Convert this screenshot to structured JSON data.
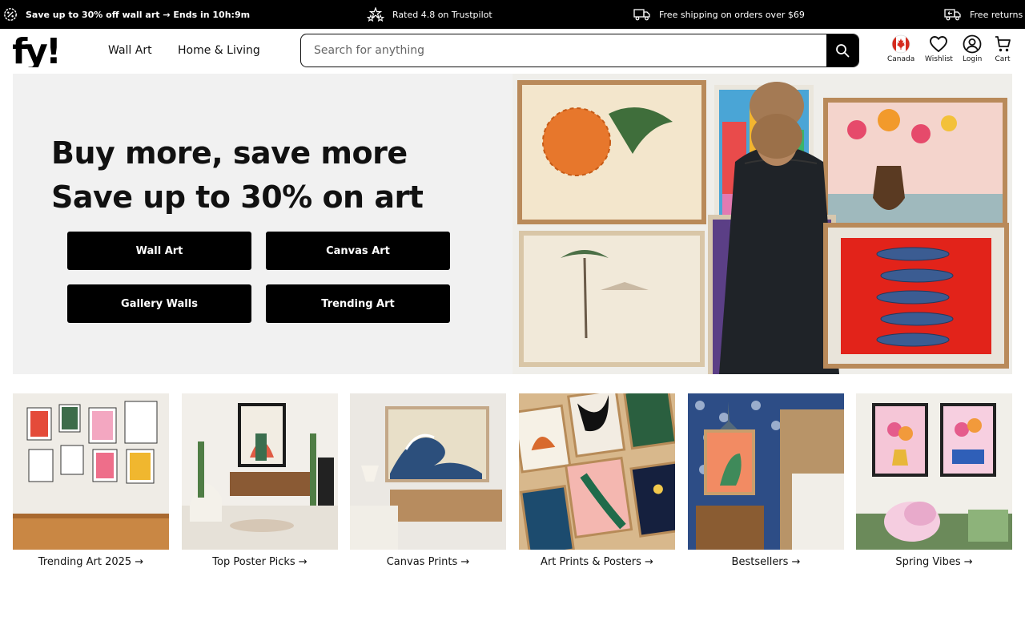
{
  "promo": {
    "items": [
      "Save up to 30% off wall art → Ends in 10h:9m",
      "Rated 4.8 on Trustpilot",
      "Free shipping on orders over $69",
      "Free returns"
    ],
    "icons": [
      "discount-badge-icon",
      "stars-icon",
      "delivery-truck-icon",
      "returns-truck-icon"
    ]
  },
  "header": {
    "logo_text": "fy!",
    "nav": [
      "Wall Art",
      "Home & Living"
    ],
    "search_placeholder": "Search for anything",
    "utils": [
      {
        "label": "Canada",
        "icon": "canada-flag-icon"
      },
      {
        "label": "Wishlist",
        "icon": "heart-icon"
      },
      {
        "label": "Login",
        "icon": "user-icon"
      },
      {
        "label": "Cart",
        "icon": "cart-icon"
      }
    ]
  },
  "hero": {
    "title_line1": "Buy more, save more",
    "title_line2": "Save up to 30% on art",
    "buttons": [
      "Wall Art",
      "Canvas Art",
      "Gallery Walls",
      "Trending Art"
    ]
  },
  "categories": [
    "Trending Art 2025 →",
    "Top Poster Picks →",
    "Canvas Prints →",
    "Art Prints & Posters →",
    "Bestsellers →",
    "Spring Vibes →"
  ],
  "colors": {
    "black": "#000000",
    "hero_bg": "#f1f1f1",
    "canada_red": "#d52b1e"
  }
}
